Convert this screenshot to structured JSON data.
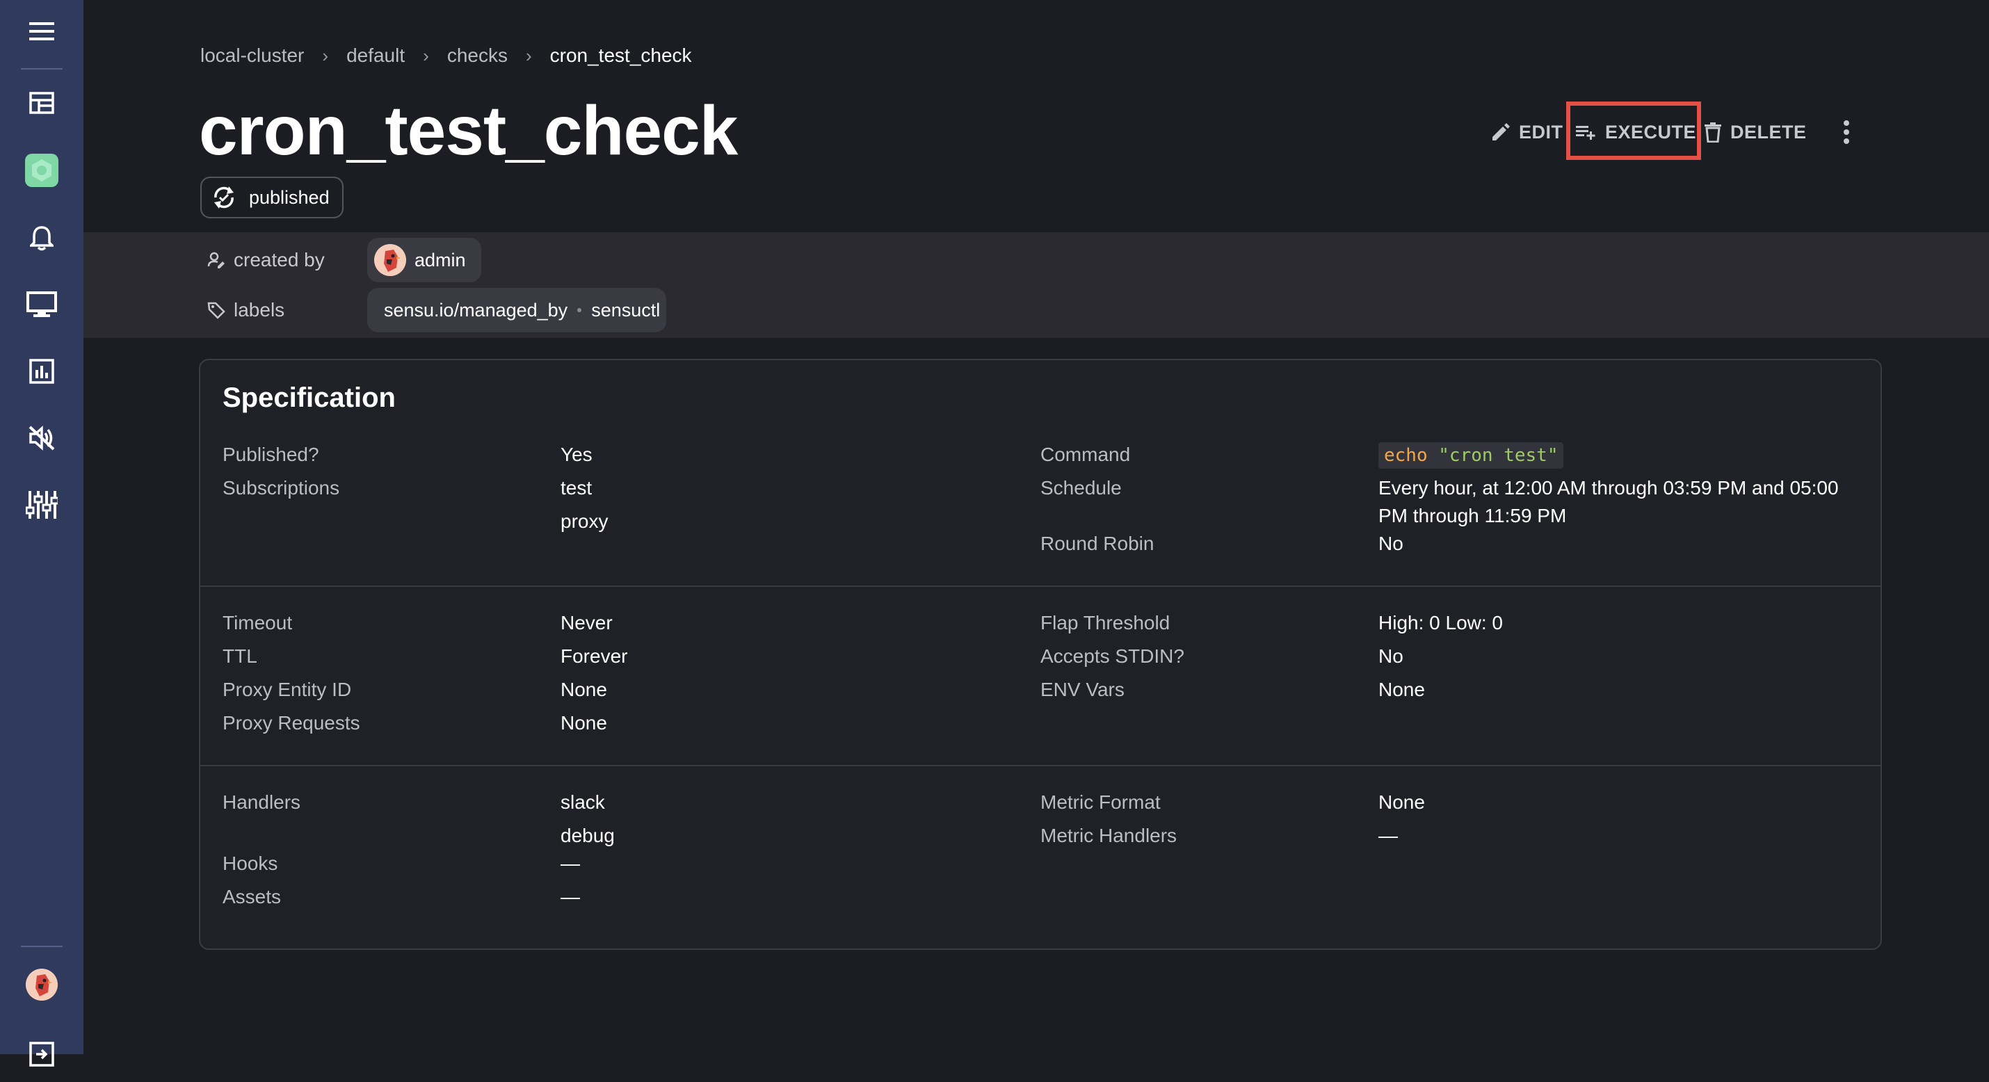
{
  "breadcrumb": {
    "items": [
      "local-cluster",
      "default",
      "checks"
    ],
    "current": "cron_test_check",
    "separator": "›"
  },
  "page": {
    "title": "cron_test_check",
    "status_label": "published"
  },
  "toolbar": {
    "edit_label": "EDIT",
    "execute_label": "EXECUTE",
    "delete_label": "DELETE",
    "highlight_color": "#e55046"
  },
  "meta": {
    "created_by_label": "created by",
    "created_by_value": "admin",
    "labels_label": "labels",
    "label_key": "sensu.io/managed_by",
    "label_value": "sensuctl"
  },
  "spec": {
    "title": "Specification",
    "published_label": "Published?",
    "published_value": "Yes",
    "subscriptions_label": "Subscriptions",
    "subscriptions": [
      "test",
      "proxy"
    ],
    "command_label": "Command",
    "command_prefix": "echo",
    "command_arg": "\"cron test\"",
    "schedule_label": "Schedule",
    "schedule_line1": "Every hour, at 12:00 AM through 03:59 PM and 05:00",
    "schedule_line2": "PM through 11:59 PM",
    "round_robin_label": "Round Robin",
    "round_robin_value": "No",
    "timeout_label": "Timeout",
    "timeout_value": "Never",
    "ttl_label": "TTL",
    "ttl_value": "Forever",
    "proxy_entity_label": "Proxy Entity ID",
    "proxy_entity_value": "None",
    "proxy_requests_label": "Proxy Requests",
    "proxy_requests_value": "None",
    "flap_label": "Flap Threshold",
    "flap_value": "High: 0 Low: 0",
    "stdin_label": "Accepts STDIN?",
    "stdin_value": "No",
    "env_label": "ENV Vars",
    "env_value": "None",
    "handlers_label": "Handlers",
    "handlers": [
      "slack",
      "debug"
    ],
    "hooks_label": "Hooks",
    "hooks_value": "—",
    "assets_label": "Assets",
    "assets_value": "—",
    "metric_format_label": "Metric Format",
    "metric_format_value": "None",
    "metric_handlers_label": "Metric Handlers",
    "metric_handlers_value": "—"
  },
  "icons": {
    "menu": "menu-icon",
    "dashboard": "dashboard-icon",
    "namespace": "namespace-icon",
    "events": "bell-icon",
    "entities": "monitor-icon",
    "checks": "chart-icon",
    "silences": "volume-off-icon",
    "config": "sliders-icon"
  },
  "colors": {
    "sidebar_bg": "#2f3a5c",
    "page_bg": "#1c1c23",
    "accent_green": "#7fd7a6",
    "code_keyword": "#f0a84a",
    "code_string": "#9ccc65"
  }
}
